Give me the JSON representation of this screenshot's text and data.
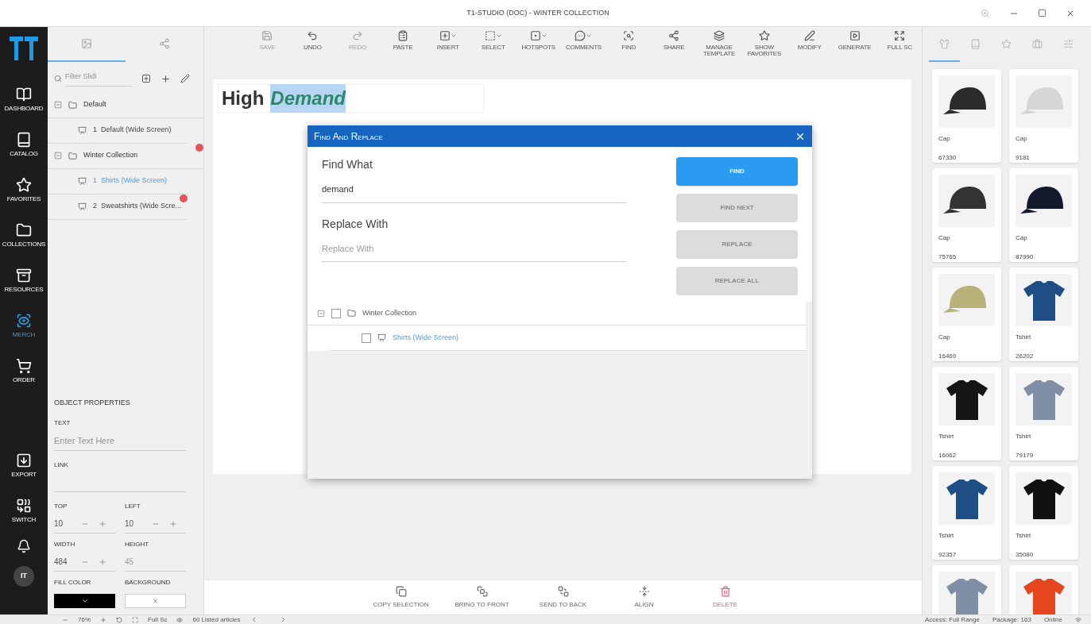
{
  "window": {
    "title": "T1-STUDIO (DOC) - WINTER COLLECTION"
  },
  "nav": [
    {
      "label": "DASHBOARD",
      "selected": false
    },
    {
      "label": "CATALOG",
      "selected": false
    },
    {
      "label": "FAVORITES",
      "selected": false
    },
    {
      "label": "COLLECTIONS",
      "selected": false
    },
    {
      "label": "RESOURCES",
      "selected": false
    },
    {
      "label": "MERCH",
      "selected": true
    },
    {
      "label": "ORDER",
      "selected": false
    },
    {
      "label": "EXPORT",
      "selected": false
    },
    {
      "label": "SWITCH",
      "selected": false
    }
  ],
  "avatar": "IT",
  "left_tabs": [
    {
      "selected": true
    },
    {
      "selected": false
    }
  ],
  "filter": {
    "placeholder": "Filter Slidi"
  },
  "slide_tree": [
    {
      "title": "Default",
      "expanded": true,
      "alert": false,
      "children": [
        {
          "number": "1",
          "title": "Default (Wide Screen)",
          "selected": false,
          "alert": false
        }
      ]
    },
    {
      "title": "Winter Collection",
      "expanded": true,
      "alert": true,
      "children": [
        {
          "number": "1",
          "title": "Shirts (Wide Screen)",
          "selected": true,
          "alert": false
        },
        {
          "number": "2",
          "title": "Sweatshirts (Wide Scre...",
          "selected": false,
          "alert": true
        }
      ]
    }
  ],
  "object_properties": {
    "title": "OBJECT PROPERTIES",
    "text_label": "TEXT",
    "text_placeholder": "Enter Text Here",
    "link_label": "LINK",
    "dims": [
      {
        "label": "TOP",
        "value": "10",
        "disabled": false
      },
      {
        "label": "LEFT",
        "value": "10",
        "disabled": false
      },
      {
        "label": "WIDTH",
        "value": "484",
        "disabled": false
      },
      {
        "label": "HEIGHT",
        "value": "45",
        "disabled": true
      }
    ],
    "fill_label": "FILL COLOR",
    "background_label": "BACKGROUND",
    "background_clear": "×"
  },
  "toolbar": [
    {
      "label": "SAVE",
      "disabled": true,
      "caret": false
    },
    {
      "label": "UNDO",
      "disabled": false,
      "caret": false
    },
    {
      "label": "REDO",
      "disabled": true,
      "caret": false
    },
    {
      "label": "PASTE",
      "disabled": false,
      "caret": false
    },
    {
      "label": "INSERT",
      "disabled": false,
      "caret": true
    },
    {
      "label": "SELECT",
      "disabled": false,
      "caret": true
    },
    {
      "label": "HOTSPOTS",
      "disabled": false,
      "caret": true
    },
    {
      "label": "COMMENTS",
      "disabled": false,
      "caret": true
    },
    {
      "label": "FIND",
      "disabled": false,
      "caret": false
    },
    {
      "label": "SHARE",
      "disabled": false,
      "caret": false
    },
    {
      "label": "MANAGE TEMPLATE",
      "disabled": false,
      "caret": false
    },
    {
      "label": "SHOW FAVORITES",
      "disabled": false,
      "caret": false
    },
    {
      "label": "MODIFY",
      "disabled": false,
      "caret": false
    },
    {
      "label": "GENERATE",
      "disabled": false,
      "caret": false
    },
    {
      "label": "FULL SC",
      "disabled": false,
      "caret": false
    }
  ],
  "slide": {
    "text": "High",
    "match": "Demand"
  },
  "dialog": {
    "title": "Find And Replace",
    "find_label": "Find What",
    "find_value": "demand",
    "replace_label": "Replace With",
    "replace_placeholder": "Replace With",
    "buttons": [
      {
        "label": "FIND",
        "disabled": false
      },
      {
        "label": "FIND NEXT",
        "disabled": true
      },
      {
        "label": "REPLACE",
        "disabled": true
      },
      {
        "label": "REPLACE ALL",
        "disabled": true
      }
    ],
    "results": [
      {
        "title": "Winter Collection",
        "checked": false,
        "expanded": true,
        "children": [
          {
            "title": "Shirts (Wide Screen)",
            "checked": false
          }
        ]
      }
    ]
  },
  "bottom_toolbar": [
    {
      "label": "COPY SELECTION",
      "kind": "normal"
    },
    {
      "label": "BRING TO FRONT",
      "kind": "normal"
    },
    {
      "label": "SEND TO BACK",
      "kind": "normal"
    },
    {
      "label": "ALIGN",
      "kind": "normal"
    },
    {
      "label": "DELETE",
      "kind": "danger"
    }
  ],
  "right_tabs": [
    {
      "selected": true
    },
    {
      "selected": false
    },
    {
      "selected": false
    },
    {
      "selected": false
    },
    {
      "selected": false
    }
  ],
  "products": [
    {
      "kind": "cap",
      "color": "#2b2b2b",
      "name": "Cap",
      "code": "67330"
    },
    {
      "kind": "cap",
      "color": "#d6d6d6",
      "name": "Cap",
      "code": "9181"
    },
    {
      "kind": "cap",
      "color": "#333333",
      "name": "Cap",
      "code": "75765"
    },
    {
      "kind": "cap",
      "color": "#141a2e",
      "name": "Cap",
      "code": "87990"
    },
    {
      "kind": "cap",
      "color": "#b8b27a",
      "name": "Cap",
      "code": "16469"
    },
    {
      "kind": "tshirt",
      "color": "#1d4f86",
      "name": "Tshirt",
      "code": "26202"
    },
    {
      "kind": "tshirt",
      "color": "#151515",
      "name": "Tshirt",
      "code": "16062"
    },
    {
      "kind": "tshirt",
      "color": "#7f8fa6",
      "name": "Tshirt",
      "code": "79179"
    },
    {
      "kind": "tshirt",
      "color": "#1d4f86",
      "name": "Tshirt",
      "code": "92357"
    },
    {
      "kind": "tshirt",
      "color": "#111111",
      "name": "Tshirt",
      "code": "35080"
    },
    {
      "kind": "tshirt",
      "color": "#7f8fa6"
    },
    {
      "kind": "tshirt",
      "color": "#e5461b"
    }
  ],
  "status_bar": {
    "zoom": "76%",
    "full": "Full Sc",
    "articles": "60 Listed articles",
    "access": "Access: Full Range",
    "package": "Package: 163",
    "online": "Online"
  }
}
